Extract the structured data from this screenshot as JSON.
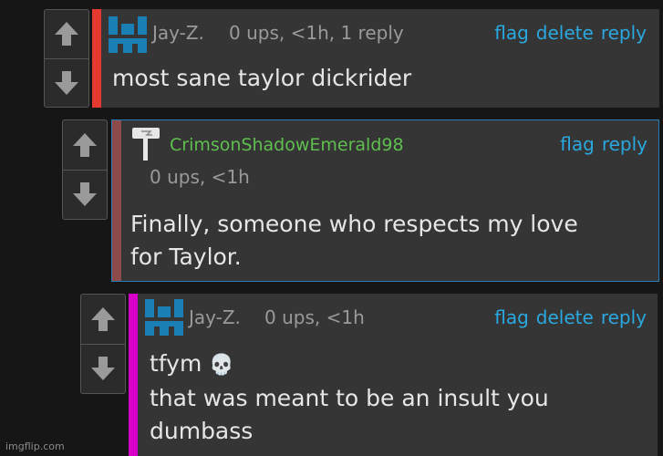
{
  "colors": {
    "accent_link": "#2aa8e0",
    "bar_red": "#e53a2f",
    "bar_rose": "#8d4a4a",
    "bar_magenta": "#d800c8",
    "username_green": "#5fbf4f",
    "avatar_blue": "#1a7fb5"
  },
  "comments": [
    {
      "username": "Jay-Z.",
      "meta": "0 ups, <1h, 1 reply",
      "actions": {
        "flag": "flag",
        "delete": "delete",
        "reply": "reply"
      },
      "body": [
        "most sane taylor dickrider"
      ],
      "avatar_icon": "blue-pixel-avatar-icon"
    },
    {
      "username": "CrimsonShadowEmerald98",
      "meta": "0 ups, <1h",
      "actions": {
        "flag": "flag",
        "reply": "reply"
      },
      "body": [
        "Finally, someone who respects my love",
        "for Taylor."
      ],
      "avatar_icon": "white-hammer-avatar-icon"
    },
    {
      "username": "Jay-Z.",
      "meta": "0 ups, <1h",
      "actions": {
        "flag": "flag",
        "delete": "delete",
        "reply": "reply"
      },
      "body": [
        "tfym",
        "that was meant to be an insult you",
        "dumbass"
      ],
      "body_emoji": "💀",
      "avatar_icon": "blue-pixel-avatar-icon"
    }
  ],
  "watermark": "imgflip.com",
  "icons": {
    "upvote": "up-arrow-icon",
    "downvote": "down-arrow-icon",
    "skull": "skull-emoji-icon"
  }
}
